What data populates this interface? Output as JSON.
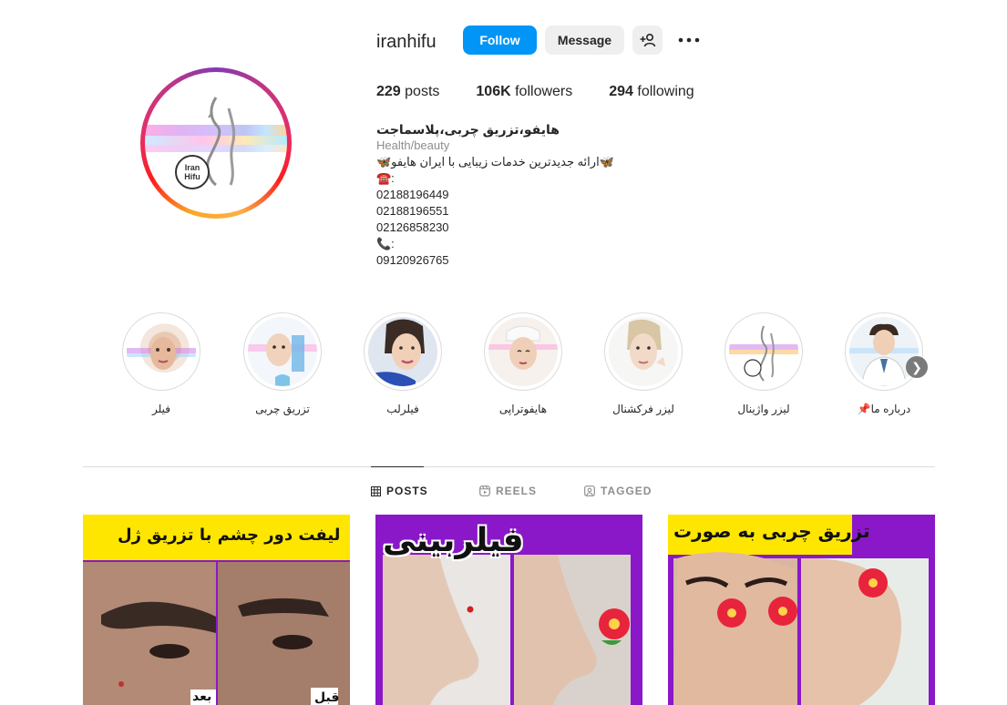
{
  "profile": {
    "username": "iranhifu",
    "follow_label": "Follow",
    "message_label": "Message",
    "avatar_text": "Iran Hifu",
    "stats": {
      "posts_count": "229",
      "posts_label": "posts",
      "followers_count": "106K",
      "followers_label": "followers",
      "following_count": "294",
      "following_label": "following"
    },
    "bio": {
      "name": "هایفو،تزریق چربی،پلاسماجت",
      "category": "Health/beauty",
      "line1": "🦋ارائه جدیدترین خدمات زیبایی با ایران هایفو🦋",
      "phone_label": "☎️:",
      "phones": [
        "02188196449",
        "02188196551",
        "02126858230"
      ],
      "mobile_label": "📞:",
      "mobile": "09120926765"
    }
  },
  "highlights": [
    {
      "label": "فیلر",
      "icon": "face-photo"
    },
    {
      "label": "تزریق چربی",
      "icon": "face-photo"
    },
    {
      "label": "فیلرلب",
      "icon": "face-photo"
    },
    {
      "label": "هایفوتراپی",
      "icon": "face-photo"
    },
    {
      "label": "لیزر فرکشنال",
      "icon": "face-photo"
    },
    {
      "label": "لیزر واژینال",
      "icon": "logo"
    },
    {
      "label": "درباره ما📌",
      "icon": "doctor-photo"
    }
  ],
  "tabs": [
    {
      "label": "POSTS",
      "active": true,
      "icon": "grid-icon"
    },
    {
      "label": "REELS",
      "active": false,
      "icon": "reels-icon"
    },
    {
      "label": "TAGGED",
      "active": false,
      "icon": "tagged-icon"
    }
  ],
  "posts": [
    {
      "caption": "لیفت دور چشم با تزریق ژل",
      "tags": [
        "قبل",
        "بعد"
      ]
    },
    {
      "caption": "فیلربینی"
    },
    {
      "caption": "تزریق چربی به صورت"
    }
  ],
  "colors": {
    "follow_blue": "#0095f6",
    "post_purple": "#8a18c9",
    "caption_yellow": "#ffe600",
    "text_primary": "#262626",
    "text_secondary": "#8e8e8e"
  }
}
